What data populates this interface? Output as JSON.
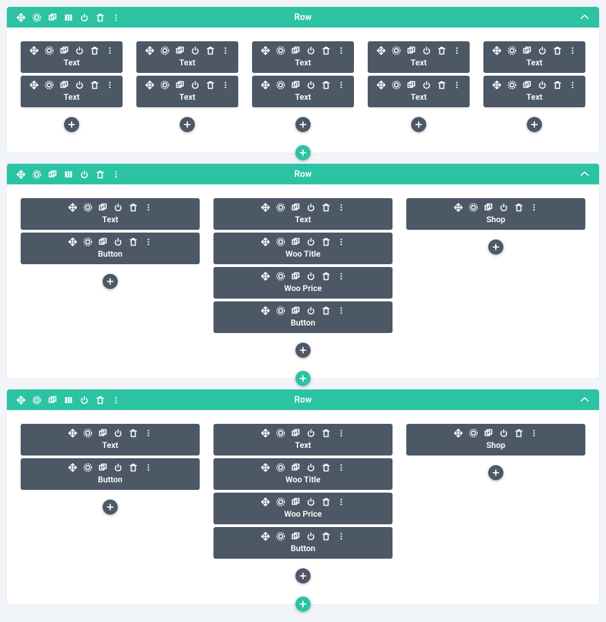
{
  "row_label": "Row",
  "sections": [
    {
      "columns": [
        {
          "modules": [
            {
              "label": "Text"
            },
            {
              "label": "Text"
            }
          ]
        },
        {
          "modules": [
            {
              "label": "Text"
            },
            {
              "label": "Text"
            }
          ]
        },
        {
          "modules": [
            {
              "label": "Text"
            },
            {
              "label": "Text"
            }
          ]
        },
        {
          "modules": [
            {
              "label": "Text"
            },
            {
              "label": "Text"
            }
          ]
        },
        {
          "modules": [
            {
              "label": "Text"
            },
            {
              "label": "Text"
            }
          ]
        }
      ]
    },
    {
      "columns": [
        {
          "modules": [
            {
              "label": "Text"
            },
            {
              "label": "Button"
            }
          ]
        },
        {
          "modules": [
            {
              "label": "Text"
            },
            {
              "label": "Woo Title"
            },
            {
              "label": "Woo Price"
            },
            {
              "label": "Button"
            }
          ]
        },
        {
          "modules": [
            {
              "label": "Shop"
            }
          ]
        }
      ]
    },
    {
      "columns": [
        {
          "modules": [
            {
              "label": "Text"
            },
            {
              "label": "Button"
            }
          ]
        },
        {
          "modules": [
            {
              "label": "Text"
            },
            {
              "label": "Woo Title"
            },
            {
              "label": "Woo Price"
            },
            {
              "label": "Button"
            }
          ]
        },
        {
          "modules": [
            {
              "label": "Shop"
            }
          ]
        }
      ]
    }
  ],
  "icons": {
    "row_header": [
      "move",
      "gear",
      "duplicate",
      "columns",
      "power",
      "trash",
      "more"
    ],
    "module": [
      "move",
      "gear",
      "duplicate",
      "power",
      "trash",
      "more"
    ]
  }
}
